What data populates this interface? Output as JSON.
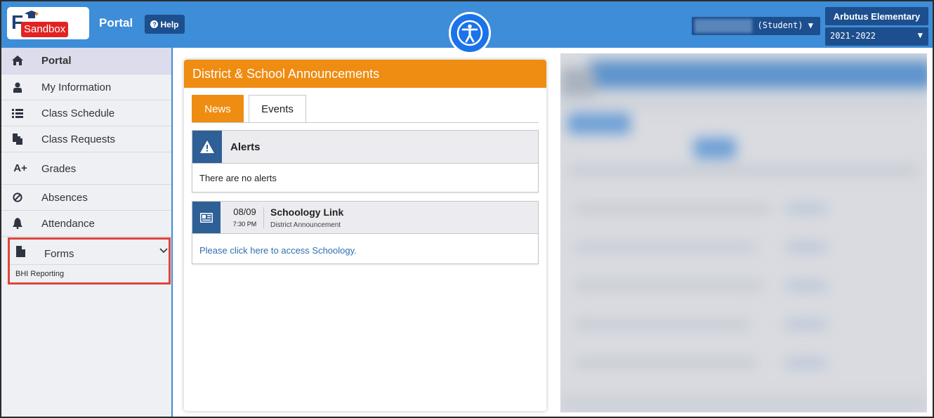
{
  "header": {
    "logo_text": "F",
    "logo_tag": "Sandbox",
    "portal_title": "Portal",
    "help_label": "Help",
    "help_icon": "question-circle-icon",
    "accessibility_icon": "accessibility-icon",
    "student_role": "(Student) ▼",
    "school_name": "Arbutus Elementary",
    "school_year": "2021-2022",
    "year_caret": "▼"
  },
  "sidebar": {
    "items": [
      {
        "label": "Portal",
        "icon": "home-icon"
      },
      {
        "label": "My Information",
        "icon": "user-icon"
      },
      {
        "label": "Class Schedule",
        "icon": "list-icon"
      },
      {
        "label": "Class Requests",
        "icon": "copy-icon"
      },
      {
        "label": "Grades",
        "icon": "a-plus-icon",
        "icon_text": "A+"
      },
      {
        "label": "Absences",
        "icon": "ban-icon"
      },
      {
        "label": "Attendance",
        "icon": "bell-icon"
      }
    ],
    "forms": {
      "label": "Forms",
      "icon": "file-icon",
      "sub_item": "BHI Reporting"
    }
  },
  "announcements": {
    "title": "District & School Announcements",
    "tabs": [
      "News",
      "Events"
    ],
    "alerts": {
      "title": "Alerts",
      "icon": "warning-icon",
      "body": "There are no alerts"
    },
    "news_item": {
      "icon": "newspaper-icon",
      "date": "08/09",
      "time": "7:30 PM",
      "title": "Schoology Link",
      "subtitle": "District Announcement",
      "link_text": "Please click here to access Schoology."
    }
  },
  "colors": {
    "header_blue": "#3d8dd8",
    "dark_blue": "#1d4f8e",
    "orange": "#ef8c12",
    "sandbox_red": "#e22323",
    "highlight_red": "#e0453a",
    "link_blue": "#2f6fb3"
  }
}
